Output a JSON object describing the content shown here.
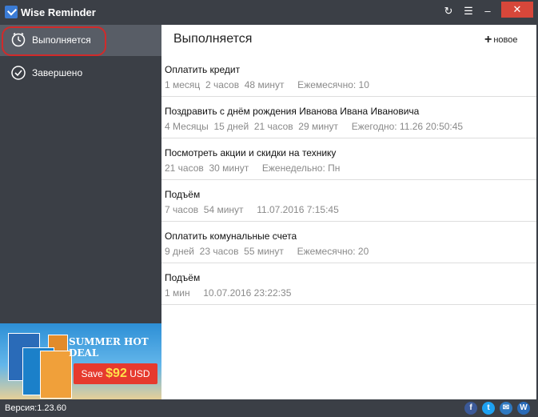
{
  "window": {
    "title": "Wise Reminder",
    "icons": [
      "refresh-icon",
      "menu-icon",
      "minimize-icon",
      "close-icon"
    ]
  },
  "sidebar": {
    "items": [
      {
        "label": "Выполняется",
        "icon": "clock-icon",
        "active": true
      },
      {
        "label": "Завершено",
        "icon": "check-circle-icon",
        "active": false
      }
    ]
  },
  "ad": {
    "title": "SUMMER HOT DEAL",
    "save_label": "Save",
    "price": "$92",
    "currency": "USD"
  },
  "main": {
    "title": "Выполняется",
    "new_label": "новое",
    "tasks": [
      {
        "title": "Оплатить кредит",
        "meta": "1 месяц  2 часов  48 минут     Ежемесячно: 10"
      },
      {
        "title": "Поздравить с днём рождения Иванова Ивана Ивановича",
        "meta": "4 Месяцы  15 дней  21 часов  29 минут     Ежегодно: 11.26 20:50:45"
      },
      {
        "title": "Посмотреть акции и скидки на технику",
        "meta": "21 часов  30 минут     Еженедельно: Пн"
      },
      {
        "title": "Подъём",
        "meta": "7 часов  54 минут     11.07.2016 7:15:45"
      },
      {
        "title": "Оплатить комунальные счета",
        "meta": "9 дней  23 часов  55 минут     Ежемесячно: 20"
      },
      {
        "title": "Подъём",
        "meta": "1 мин     10.07.2016 23:22:35"
      }
    ]
  },
  "status": {
    "version": "Версия:1.23.60",
    "social_icons": [
      "facebook-icon",
      "twitter-icon",
      "mail-icon",
      "wise-icon"
    ]
  },
  "colors": {
    "sidebar_bg": "#3b3f46",
    "active_item_bg": "#585d66",
    "close_button": "#d7473a",
    "highlight_outline": "#d22a2a",
    "meta_text": "#8a8a8a"
  }
}
